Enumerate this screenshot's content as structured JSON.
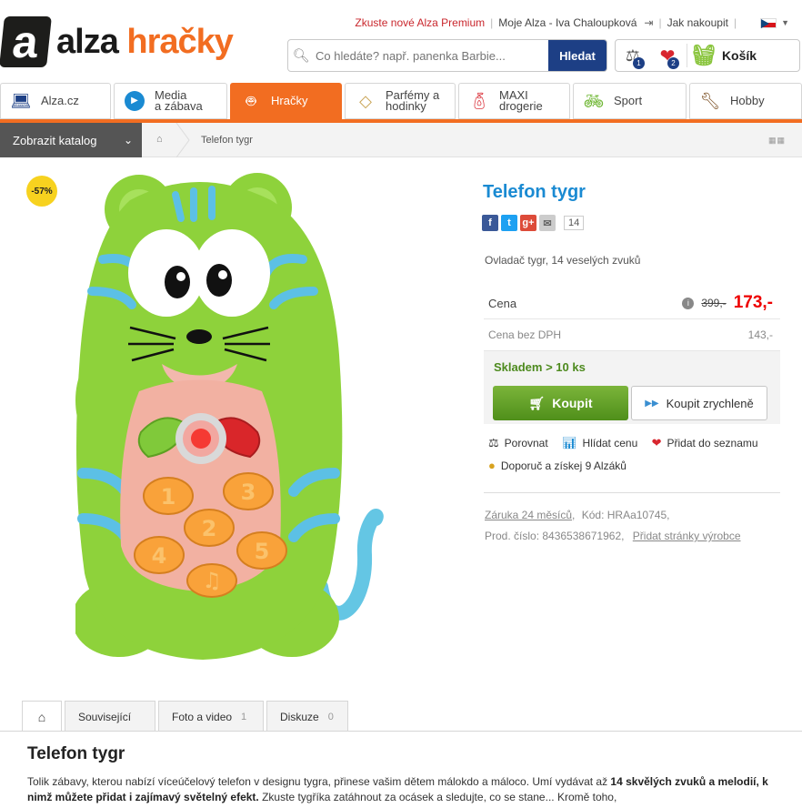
{
  "header": {
    "logo_mark": "a",
    "logo_word1": "alza",
    "logo_word2": "hračky",
    "links": {
      "premium": "Zkuste nové Alza Premium",
      "account": "Moje Alza - Iva Chaloupková",
      "howto": "Jak nakoupit"
    },
    "search_placeholder": "Co hledáte? např. panenka Barbie...",
    "search_button": "Hledat",
    "compare_count": "1",
    "favorites_count": "2",
    "cart_label": "Košík"
  },
  "categories": [
    {
      "label": "Alza.cz",
      "icon": "laptop-icon"
    },
    {
      "label": "Media\na zábava",
      "icon": "play-icon"
    },
    {
      "label": "Hračky",
      "icon": "robot-icon",
      "active": true
    },
    {
      "label": "Parfémy a\nhodinky",
      "icon": "diamond-icon"
    },
    {
      "label": "MAXI\ndrogerie",
      "icon": "bottle-icon"
    },
    {
      "label": "Sport",
      "icon": "bicycle-icon"
    },
    {
      "label": "Hobby",
      "icon": "drill-icon"
    }
  ],
  "breadcrumb": {
    "catalog_button": "Zobrazit katalog",
    "current": "Telefon tygr"
  },
  "product": {
    "discount": "-57%",
    "title": "Telefon tygr",
    "share_count": "14",
    "subtitle": "Ovladač tygr, 14 veselých zvuků",
    "price_label": "Cena",
    "old_price": "399,-",
    "price": "173,-",
    "price_no_vat_label": "Cena bez DPH",
    "price_no_vat": "143,-",
    "stock": "Skladem > 10 ks",
    "buy_button": "Koupit",
    "quick_buy_button": "Koupit zrychleně",
    "actions": {
      "compare": "Porovnat",
      "watch": "Hlídat cenu",
      "wishlist": "Přidat do seznamu",
      "recommend": "Doporuč a získej 9 Alzáků"
    },
    "warranty": "Záruka 24 měsíců",
    "code_label": "Kód: HRAa10745,",
    "part_label": "Prod. číslo: 8436538671962,",
    "maker_link": "Přidat stránky výrobce"
  },
  "tabs": [
    {
      "label": "Související",
      "count": ""
    },
    {
      "label": "Foto a video",
      "count": "1"
    },
    {
      "label": "Diskuze",
      "count": "0"
    }
  ],
  "description": {
    "title": "Telefon tygr",
    "text1": "Tolik zábavy, kterou nabízí víceúčelový telefon v designu tygra, přinese vašim dětem málokdo a máloco. Umí vydávat až ",
    "bold1": "14 skvělých zvuků a melodií, k nimž můžete přidat i zajímavý světelný efekt.",
    "text2": " Zkuste tygříka zatáhnout za ocásek a sledujte, co se stane... Kromě toho,"
  },
  "colors": {
    "brand_orange": "#f26d21",
    "brand_blue": "#1d3f85",
    "title_blue": "#1a8ad2",
    "price_red": "#e00000",
    "stock_green": "#4d8a1e"
  }
}
